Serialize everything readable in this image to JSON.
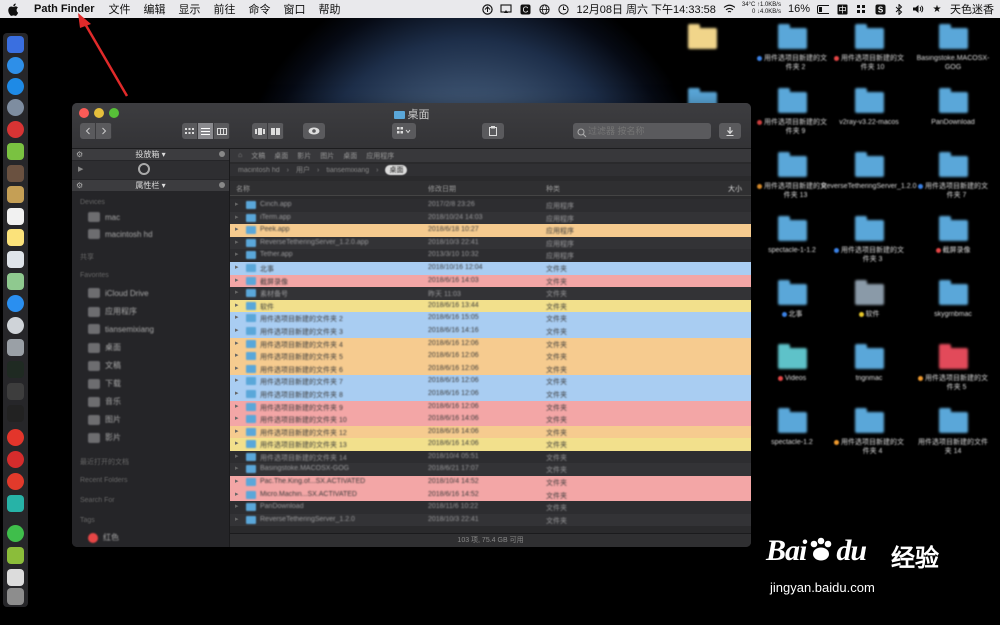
{
  "menubar": {
    "app_name": "Path Finder",
    "menus": [
      "文件",
      "编辑",
      "显示",
      "前往",
      "命令",
      "窗口",
      "帮助"
    ],
    "net_up": "1.0KB/s",
    "net_down": "4.0KB/s",
    "temp": "34°C",
    "net_zero": "0",
    "clock": "12月08日 周六 下午14:33:58",
    "battery": "16%",
    "user": "天色迷香"
  },
  "window": {
    "title": "桌面",
    "search_placeholder": "过滤器 按名称",
    "sidebar": {
      "header1": "投放箱",
      "header2": "属性栏",
      "sections": [
        "Devices",
        "共享",
        "Favorites",
        "最近打开的文档",
        "Recent Folders",
        "Search For",
        "Tags"
      ],
      "devices": [
        "mac",
        "macintosh hd"
      ],
      "favorites": [
        "iCloud Drive",
        "应用程序",
        "tiansemixiang",
        "桌面",
        "文稿",
        "下载",
        "音乐",
        "图片",
        "影片"
      ],
      "tags": [
        "红色"
      ]
    },
    "tabs": [
      "文稿",
      "桌面",
      "影片",
      "图片",
      "桌面",
      "应用程序"
    ],
    "path": [
      "macintosh hd",
      "用户",
      "tiansemixiang",
      "桌面"
    ],
    "columns": {
      "name": "名称",
      "date": "修改日期",
      "kind": "种类",
      "size": "大小"
    },
    "rows": [
      {
        "name": "Cinch.app",
        "date": "2017/2/8 23:26",
        "kind": "应用程序",
        "tag": "none"
      },
      {
        "name": "iTerm.app",
        "date": "2018/10/24 14:03",
        "kind": "应用程序",
        "tag": "none"
      },
      {
        "name": "Peek.app",
        "date": "2018/6/18 10:27",
        "kind": "应用程序",
        "tag": "orange"
      },
      {
        "name": "ReverseTetheringServer_1.2.0.app",
        "date": "2018/10/3 22:41",
        "kind": "应用程序",
        "tag": "none"
      },
      {
        "name": "Tether.app",
        "date": "2013/3/10 10:32",
        "kind": "应用程序",
        "tag": "none"
      },
      {
        "name": "北事",
        "date": "2018/10/16 12:04",
        "kind": "文件夹",
        "tag": "blue"
      },
      {
        "name": "截屏录像",
        "date": "2018/6/16 14:03",
        "kind": "文件夹",
        "tag": "red"
      },
      {
        "name": "素材备号",
        "date": "昨天 11:03",
        "kind": "文件夹",
        "tag": "none"
      },
      {
        "name": "软件",
        "date": "2018/6/16 13:44",
        "kind": "文件夹",
        "tag": "yellow"
      },
      {
        "name": "用件选项目新建的文件夹 2",
        "date": "2018/6/16 15:05",
        "kind": "文件夹",
        "tag": "blue"
      },
      {
        "name": "用件选项目新建的文件夹 3",
        "date": "2018/6/16 14:16",
        "kind": "文件夹",
        "tag": "blue"
      },
      {
        "name": "用件选项目新建的文件夹 4",
        "date": "2018/6/16 12:06",
        "kind": "文件夹",
        "tag": "orange"
      },
      {
        "name": "用件选项目新建的文件夹 5",
        "date": "2018/6/16 12:06",
        "kind": "文件夹",
        "tag": "orange"
      },
      {
        "name": "用件选项目新建的文件夹 6",
        "date": "2018/6/16 12:06",
        "kind": "文件夹",
        "tag": "orange"
      },
      {
        "name": "用件选项目新建的文件夹 7",
        "date": "2018/6/16 12:06",
        "kind": "文件夹",
        "tag": "blue"
      },
      {
        "name": "用件选项目新建的文件夹 8",
        "date": "2018/6/16 12:06",
        "kind": "文件夹",
        "tag": "blue"
      },
      {
        "name": "用件选项目新建的文件夹 9",
        "date": "2018/6/16 12:06",
        "kind": "文件夹",
        "tag": "red"
      },
      {
        "name": "用件选项目新建的文件夹 10",
        "date": "2018/6/16 14:06",
        "kind": "文件夹",
        "tag": "red"
      },
      {
        "name": "用件选项目新建的文件夹 12",
        "date": "2018/6/16 14:06",
        "kind": "文件夹",
        "tag": "orange"
      },
      {
        "name": "用件选项目新建的文件夹 13",
        "date": "2018/6/16 14:06",
        "kind": "文件夹",
        "tag": "yellow"
      },
      {
        "name": "用件选项目新建的文件夹 14",
        "date": "2018/10/4 05:51",
        "kind": "文件夹",
        "tag": "none"
      },
      {
        "name": "Basingstoke.MACOSX-GOG",
        "date": "2018/6/21 17:07",
        "kind": "文件夹",
        "tag": "none"
      },
      {
        "name": "Pac.The.King.of...SX.ACTIVATED",
        "date": "2018/10/4 14:52",
        "kind": "文件夹",
        "tag": "red"
      },
      {
        "name": "Micro.Machin...SX.ACTIVATED",
        "date": "2018/6/16 14:52",
        "kind": "文件夹",
        "tag": "red"
      },
      {
        "name": "PanDownload",
        "date": "2018/11/6 10:22",
        "kind": "文件夹",
        "tag": "none"
      },
      {
        "name": "ReverseTetheringServer_1.2.0",
        "date": "2018/10/3 22:41",
        "kind": "文件夹",
        "tag": "none"
      }
    ],
    "status": "103 项, 75.4 GB 可用"
  },
  "desktop_icons": [
    {
      "label": "",
      "dot": "none",
      "color": "yellow"
    },
    {
      "label": "用件选项目新建的文件夹 2",
      "dot": "blue",
      "color": "blue"
    },
    {
      "label": "用件选项目新建的文件夹 10",
      "dot": "red",
      "color": "blue"
    },
    {
      "label": "Basingstoke.MACOSX-GOG",
      "dot": "none",
      "color": "blue"
    },
    {
      "label": "素材备号",
      "dot": "none",
      "color": "blue"
    },
    {
      "label": "用件选项目新建的文件夹 9",
      "dot": "red",
      "color": "blue"
    },
    {
      "label": "v2ray-v3.22-macos",
      "dot": "none",
      "color": "blue"
    },
    {
      "label": "PanDownload",
      "dot": "none",
      "color": "blue"
    },
    {
      "label": "用件选项目新建的文件夹 8",
      "dot": "blue",
      "color": "blue"
    },
    {
      "label": "用件选项目新建的文件夹 13",
      "dot": "orange",
      "color": "blue"
    },
    {
      "label": "ReverseTetheringServer_1.2.0",
      "dot": "none",
      "color": "blue"
    },
    {
      "label": "用件选项目新建的文件夹 7",
      "dot": "blue",
      "color": "blue"
    },
    {
      "label": "用件选项目新建的文件夹 12",
      "dot": "orange",
      "color": "blue"
    },
    {
      "label": "spectacle-1-1.2",
      "dot": "none",
      "color": "blue"
    },
    {
      "label": "用件选项目新建的文件夹 3",
      "dot": "blue",
      "color": "blue"
    },
    {
      "label": "截屏录像",
      "dot": "red",
      "color": "blue"
    },
    {
      "label": "Usystem",
      "dot": "none",
      "color": "blue"
    },
    {
      "label": "北事",
      "dot": "blue",
      "color": "blue"
    },
    {
      "label": "软件",
      "dot": "yellow",
      "color": "gray"
    },
    {
      "label": "skygrnbmac",
      "dot": "none",
      "color": "blue"
    },
    {
      "label": "用件选项目新建的文件夹 6",
      "dot": "orange",
      "color": "red"
    },
    {
      "label": "Videos",
      "dot": "red",
      "color": "teal"
    },
    {
      "label": "tngnmac",
      "dot": "none",
      "color": "blue"
    },
    {
      "label": "用件选项目新建的文件夹 5",
      "dot": "orange",
      "color": "red"
    },
    {
      "label": "Micro.Machin...ATED",
      "dot": "red",
      "color": "blue"
    },
    {
      "label": "spectacle-1.2",
      "dot": "none",
      "color": "blue"
    },
    {
      "label": "用件选项目新建的文件夹 4",
      "dot": "orange",
      "color": "blue"
    },
    {
      "label": "用件选项目新建的文件夹 14",
      "dot": "none",
      "color": "blue"
    }
  ],
  "watermark": {
    "logo": "Bai",
    "logo2": "du",
    "cn": "经验",
    "url": "jingyan.baidu.com"
  },
  "colors": {
    "tag_blue": "#a9cdf2",
    "tag_red": "#f3a6a6",
    "tag_orange": "#f6cb8f",
    "tag_yellow": "#f2e08c",
    "row_dark": "#2d2d30",
    "row_dark_alt": "#333336",
    "dot_blue": "#3b82e6",
    "dot_red": "#e64646",
    "dot_orange": "#f09a2e",
    "dot_yellow": "#e9c92a",
    "folder_blue": "#5aa7d9",
    "folder_red": "#e24a5a",
    "folder_teal": "#5ec2c9",
    "folder_gray": "#8a9aa8",
    "folder_yellow": "#f1d58a"
  }
}
